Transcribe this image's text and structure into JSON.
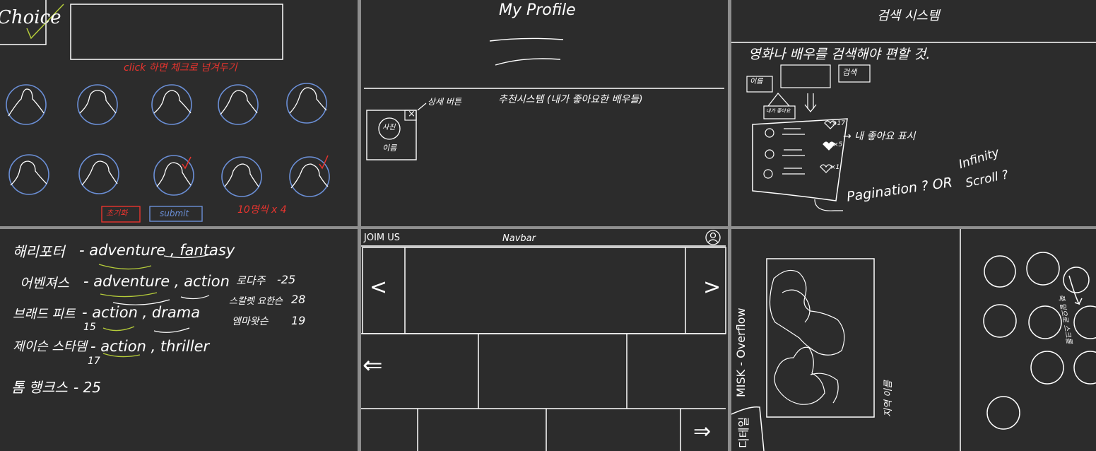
{
  "colors": {
    "board": "#2c2c2c",
    "gap": "#8e8e8e",
    "chalk": "#ffffff",
    "red": "#e8342e",
    "blue": "#6b8fd6",
    "green": "#b5cc3a"
  },
  "p1": {
    "choice_label": "Choice",
    "red_note": "click 하면 체크로 넘겨두기",
    "reset_label": "초기화",
    "submit_label": "submit",
    "count_note": "10명씩 x 4"
  },
  "p2": {
    "title": "My Profile",
    "detail_note": "상세 버튼",
    "recommend_note": "추천시스템 (내가 좋아요한 배우들)",
    "photo_label": "사진",
    "name_label": "이름",
    "close_mark": "×"
  },
  "p3": {
    "title": "검색 시스템",
    "note": "영화나 배우를 검색해야 편할 것.",
    "name_box": "이름",
    "search_button": "검색",
    "sort_box": "내가 좋아요",
    "like_note": "→ 내 좋아요 표시",
    "like_counts": [
      "×17",
      "×5",
      "×1"
    ],
    "pagination": "Pagination ? OR",
    "infinity": "Infinity",
    "scroll": "Scroll ?"
  },
  "p4": {
    "rows": [
      {
        "title": "해리포터",
        "genres": "- adventure , fantasy",
        "sub": ""
      },
      {
        "title": "어벤져스",
        "genres": "- adventure , action",
        "sub": ""
      },
      {
        "title": "브래드 피트",
        "genres": "- action , drama",
        "sub": "15"
      },
      {
        "title": "제이슨 스타뎀",
        "genres": "- action , thriller",
        "sub": "17"
      },
      {
        "title": "톰 행크스",
        "genres": "- 25",
        "sub": ""
      }
    ],
    "stats": [
      {
        "label": "로다주",
        "value": "-25"
      },
      {
        "label": "스칼렛 요한슨",
        "value": "28"
      },
      {
        "label": "엠마왓슨",
        "value": "19"
      }
    ]
  },
  "p5": {
    "join": "JOIM US",
    "navbar": "Navbar",
    "prev": "<",
    "next": ">",
    "back": "⇐",
    "forward": "⇒"
  },
  "p6": {
    "vertical_title": "MISK - Overflow",
    "tab_label": "디테일",
    "side_note": "지역 이름",
    "right_note": "쭉 밑으로 스크롤"
  }
}
